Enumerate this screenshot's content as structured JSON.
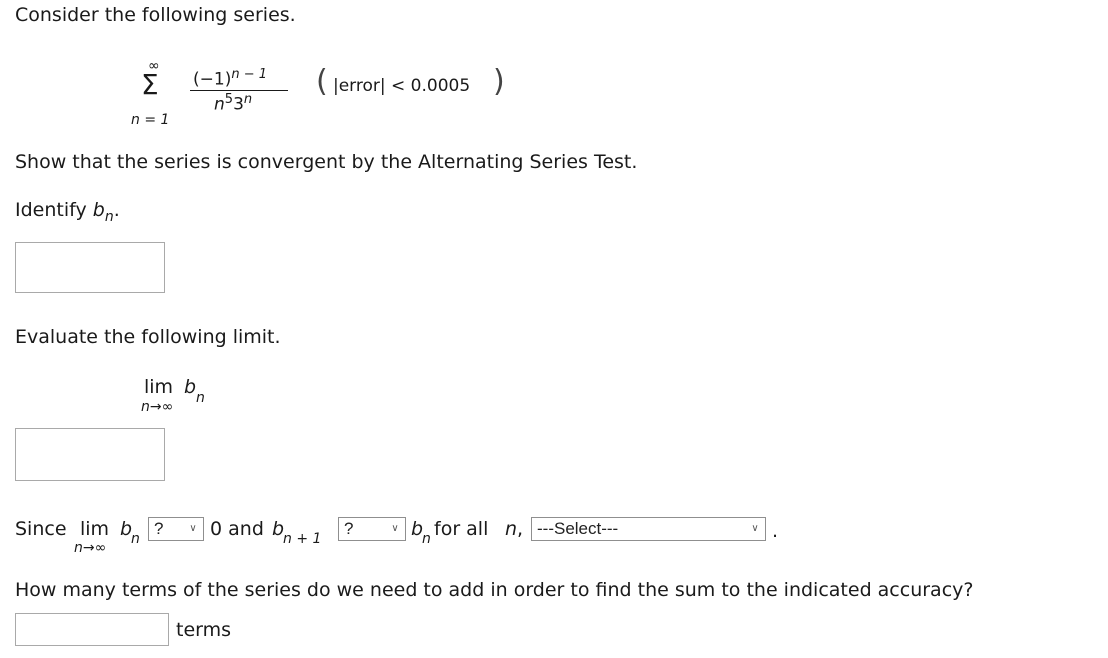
{
  "intro": "Consider the following series.",
  "series": {
    "sigma": "Σ",
    "upper": "∞",
    "lower": "n = 1",
    "numerator_base": "(−1)",
    "numerator_exp": "n − 1",
    "denominator_n": "n",
    "denominator_n_exp": "5",
    "denominator_3": "3",
    "denominator_3_exp": "n",
    "paren_open": "(",
    "paren_close": ")",
    "error_text": "|error| < 0.0005"
  },
  "prompt_show": "Show that the series is convergent by the Alternating Series Test.",
  "identify": {
    "label": "Identify ",
    "b": "b",
    "sub": "n",
    "dot": ".",
    "input_value": ""
  },
  "evaluate_label": "Evaluate the following limit.",
  "limit": {
    "lim": "lim",
    "b": "b",
    "sub": "n",
    "under": "n→∞",
    "input_value": ""
  },
  "since": {
    "since": "Since ",
    "lim": "lim",
    "under": "n→∞",
    "b": "b",
    "sub": "n",
    "select1": "?",
    "text_zero_and": "0 and ",
    "b2": "b",
    "sub2": "n + 1",
    "select2": "?",
    "b3": "b",
    "sub3": "n",
    "text_for_all": " for all ",
    "n": "n",
    "comma": ",",
    "select3": "---Select---",
    "period": "."
  },
  "question": "How many terms of the series do we need to add in order to find the sum to the indicated accuracy?",
  "terms": {
    "input_value": "",
    "label": "terms"
  },
  "icons": {
    "chevron": "chevron-down-icon"
  }
}
